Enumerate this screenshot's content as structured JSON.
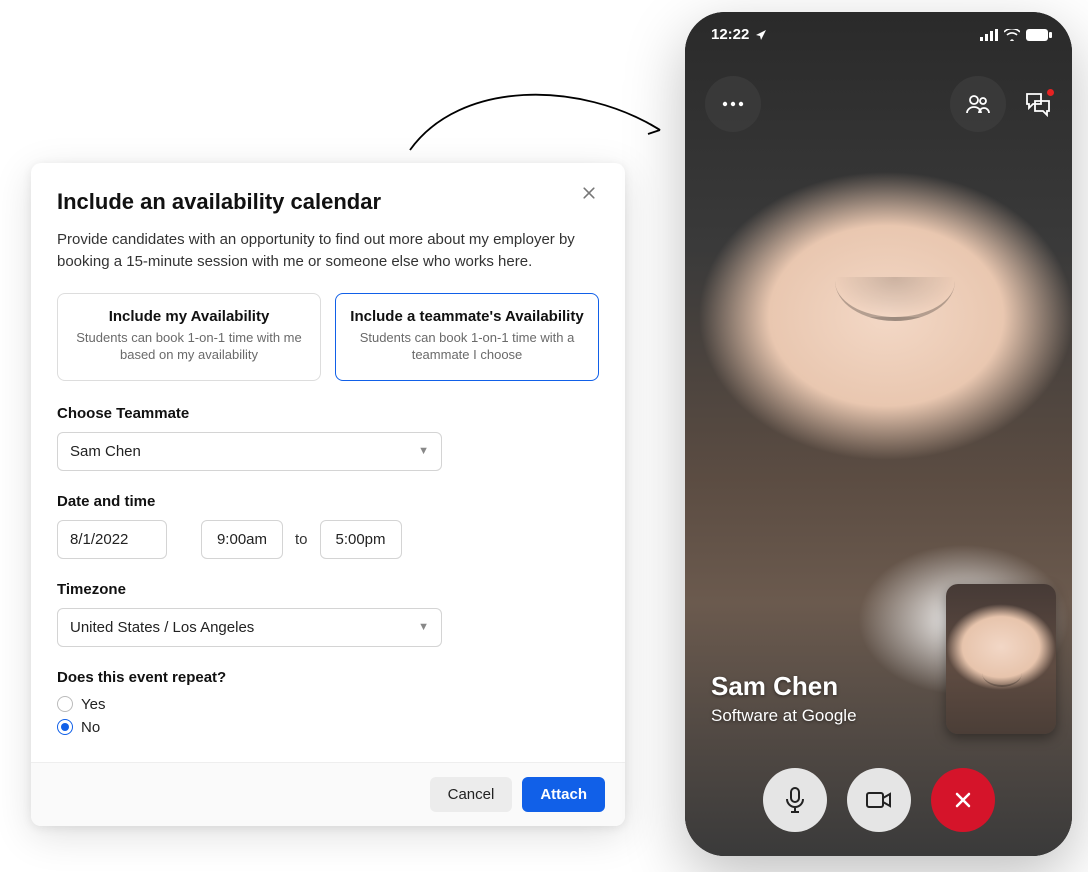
{
  "modal": {
    "title": "Include an availability calendar",
    "description": "Provide candidates with an opportunity to find out more about my employer by booking a 15-minute session with me or someone else who works here.",
    "options": [
      {
        "title": "Include my Availability",
        "sub": "Students can book 1-on-1 time with me based on my availability"
      },
      {
        "title": "Include a teammate's Availability",
        "sub": "Students can book 1-on-1 time with a teammate I choose"
      }
    ],
    "teammate": {
      "label": "Choose Teammate",
      "value": "Sam Chen"
    },
    "datetime": {
      "label": "Date and time",
      "date": "8/1/2022",
      "start": "9:00am",
      "to": "to",
      "end": "5:00pm"
    },
    "timezone": {
      "label": "Timezone",
      "value": "United States / Los Angeles"
    },
    "repeat": {
      "label": "Does this event repeat?",
      "yes": "Yes",
      "no": "No",
      "value": "No"
    },
    "buttons": {
      "cancel": "Cancel",
      "attach": "Attach"
    }
  },
  "phone": {
    "time": "12:22",
    "caller": {
      "name": "Sam Chen",
      "subtitle": "Software at Google"
    },
    "icons": {
      "more": "more-icon",
      "people": "people-icon",
      "chat": "chat-icon",
      "mic": "mic-icon",
      "video": "video-icon",
      "end": "end-call-icon"
    }
  },
  "colors": {
    "primary": "#1160e8",
    "danger": "#d5142a"
  }
}
